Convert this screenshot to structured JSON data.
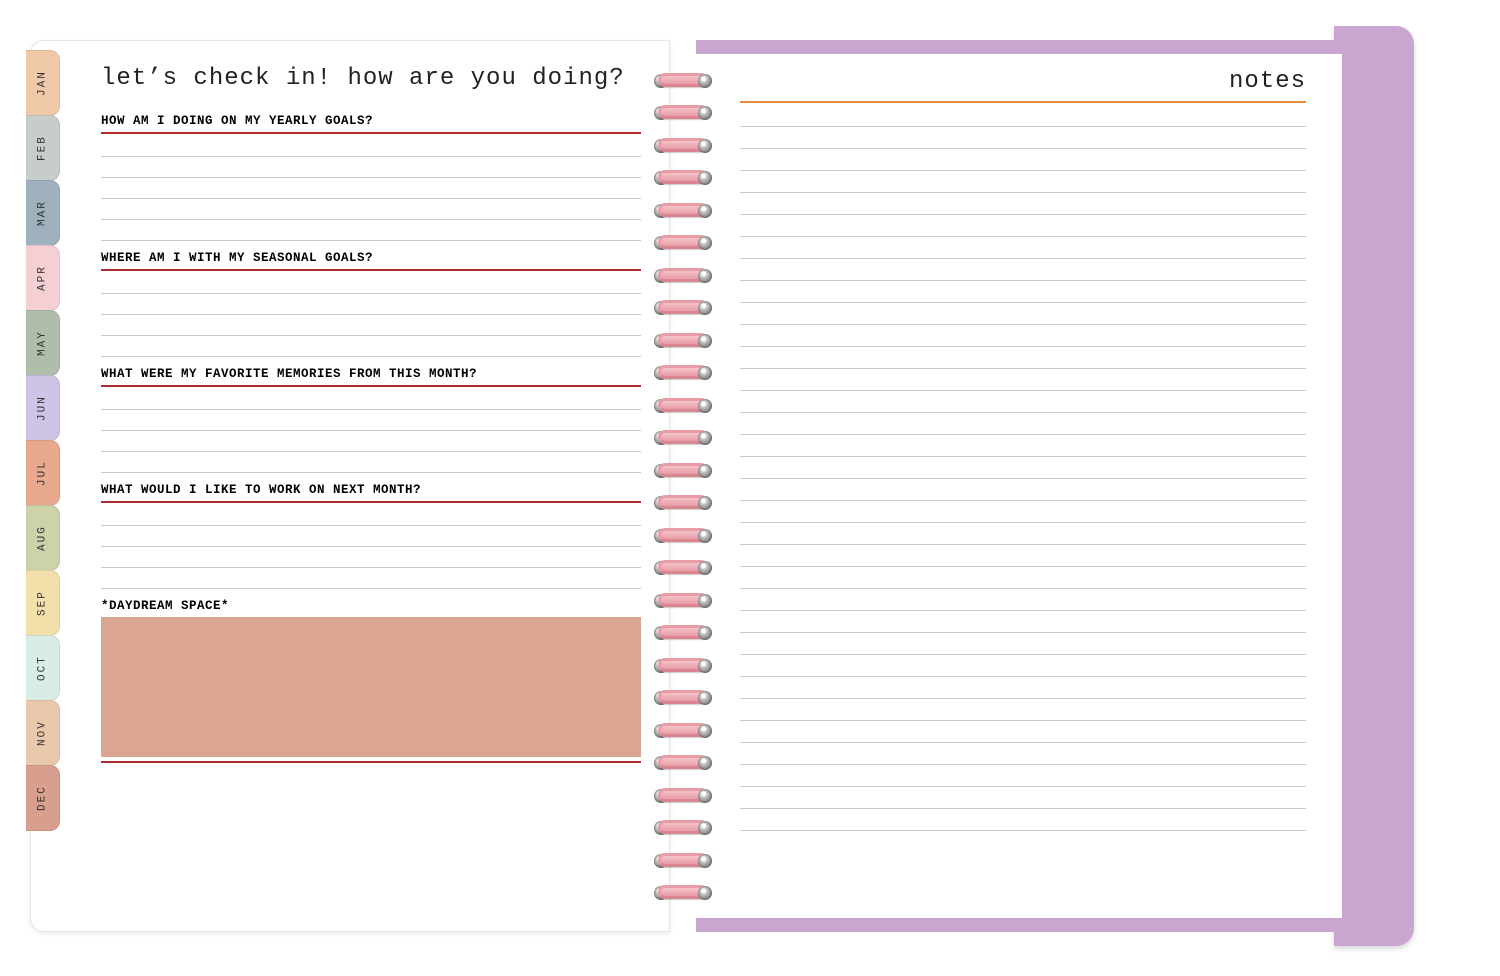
{
  "tabs": [
    {
      "label": "JAN",
      "color": "#f0c9a8"
    },
    {
      "label": "FEB",
      "color": "#c7ceca"
    },
    {
      "label": "MAR",
      "color": "#9fb1bd"
    },
    {
      "label": "APR",
      "color": "#f4cfd4"
    },
    {
      "label": "MAY",
      "color": "#b0bdaa"
    },
    {
      "label": "JUN",
      "color": "#cfc3e6"
    },
    {
      "label": "JUL",
      "color": "#e8a98e"
    },
    {
      "label": "AUG",
      "color": "#cdd2a8"
    },
    {
      "label": "SEP",
      "color": "#f3dfaa"
    },
    {
      "label": "OCT",
      "color": "#d7ede5"
    },
    {
      "label": "NOV",
      "color": "#e9c9ab"
    },
    {
      "label": "DEC",
      "color": "#d89e8e"
    }
  ],
  "left": {
    "title": "let’s check in! how are you doing?",
    "prompts": [
      "HOW AM I DOING ON MY YEARLY GOALS?",
      "WHERE AM I WITH MY SEASONAL GOALS?",
      "WHAT WERE MY FAVORITE MEMORIES FROM THIS MONTH?",
      "WHAT WOULD I LIKE TO WORK ON NEXT MONTH?"
    ],
    "daydream_label": "*DAYDREAM SPACE*"
  },
  "right": {
    "title": "notes"
  },
  "colors": {
    "red_rule": "#b02c2c",
    "orange_rule": "#e38b3a",
    "daydream_fill": "#dba593",
    "lavender_border": "#c8a6cf"
  }
}
